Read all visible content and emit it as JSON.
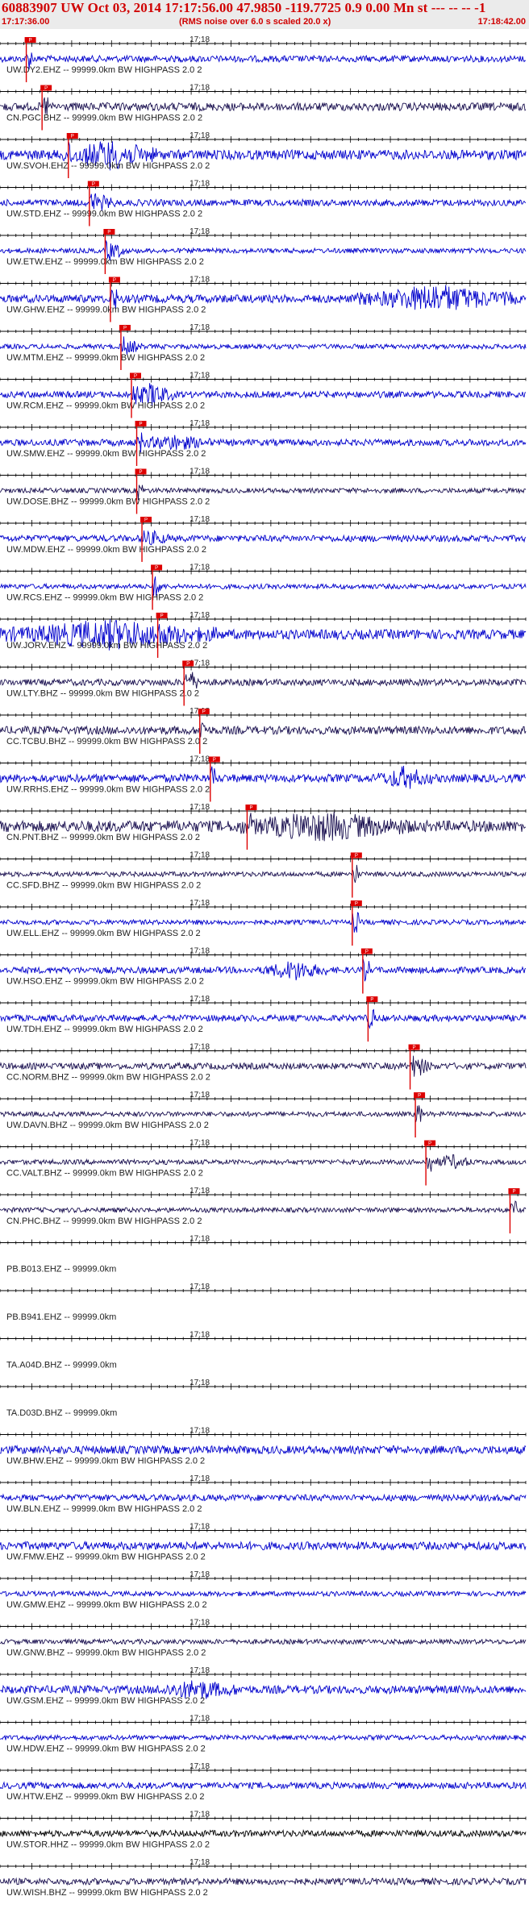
{
  "header": {
    "title": "60883907 UW Oct 03, 2014 17:17:56.00   47.9850 -119.7725  0.9 0.00 Mn st --- -- --  -1",
    "subtitle": "(RMS noise over 6.0 s scaled 20.0 x)",
    "time_start": "17:17:36.00",
    "time_end": "17:18:42.00"
  },
  "colors": {
    "title": "#d00000",
    "trace_blue": "#0000cc",
    "trace_dark": "#1a1050",
    "pick": "#dd0000",
    "axis": "#000000"
  },
  "chart_data": {
    "type": "line",
    "title": "60883907 UW Oct 03, 2014 17:17:56.00",
    "x_start": "17:17:36.00",
    "x_end": "17:18:42.00",
    "minute_tick_label": "17:18",
    "pick_label": "P",
    "traces": [
      {
        "label": "UW.DY2.EHZ -- 99999.0km BW  HIGHPASS  2.0 2",
        "pick": 0.05,
        "color": "blue",
        "amp": 4,
        "burst": null
      },
      {
        "label": "CN.PGC.BHZ -- 99999.0km BW  HIGHPASS  2.0 2",
        "pick": 0.08,
        "color": "dark",
        "amp": 5,
        "burst": null
      },
      {
        "label": "UW.SVOH.EHZ -- 99999.0km BW  HIGHPASS  2.0 2",
        "pick": 0.13,
        "color": "blue",
        "amp": 6,
        "burst": [
          0.12,
          0.3,
          14
        ]
      },
      {
        "label": "UW.STD.EHZ -- 99999.0km BW  HIGHPASS  2.0 2",
        "pick": 0.17,
        "color": "blue",
        "amp": 4,
        "burst": [
          0.17,
          0.22,
          6
        ]
      },
      {
        "label": "UW.ETW.EHZ -- 99999.0km BW  HIGHPASS  2.0 2",
        "pick": 0.2,
        "color": "blue",
        "amp": 3,
        "burst": [
          0.2,
          0.24,
          8
        ]
      },
      {
        "label": "UW.GHW.EHZ -- 99999.0km BW  HIGHPASS  2.0 2",
        "pick": 0.21,
        "color": "blue",
        "amp": 5,
        "burst": [
          0.68,
          0.98,
          14
        ]
      },
      {
        "label": "UW.MTM.EHZ -- 99999.0km BW  HIGHPASS  2.0 2",
        "pick": 0.23,
        "color": "blue",
        "amp": 3,
        "burst": [
          0.23,
          0.27,
          6
        ]
      },
      {
        "label": "UW.RCM.EHZ -- 99999.0km BW  HIGHPASS  2.0 2",
        "pick": 0.25,
        "color": "blue",
        "amp": 4,
        "burst": [
          0.25,
          0.33,
          12
        ]
      },
      {
        "label": "UW.SMW.EHZ -- 99999.0km BW  HIGHPASS  2.0 2",
        "pick": 0.26,
        "color": "blue",
        "amp": 4,
        "burst": [
          0.26,
          0.4,
          7
        ]
      },
      {
        "label": "UW.DOSE.BHZ -- 99999.0km BW  HIGHPASS  2.0 2",
        "pick": 0.26,
        "color": "dark",
        "amp": 3,
        "burst": null
      },
      {
        "label": "UW.MDW.EHZ -- 99999.0km BW  HIGHPASS  2.0 2",
        "pick": 0.27,
        "color": "blue",
        "amp": 4,
        "burst": [
          0.27,
          0.32,
          6
        ]
      },
      {
        "label": "UW.RCS.EHZ -- 99999.0km BW  HIGHPASS  2.0 2",
        "pick": 0.29,
        "color": "blue",
        "amp": 3,
        "burst": [
          0.29,
          0.31,
          10
        ]
      },
      {
        "label": "UW.JORV.EHZ -- 99999.0km BW  HIGHPASS  2.0 2",
        "pick": 0.3,
        "color": "blue",
        "amp": 6,
        "burst": [
          0.0,
          0.42,
          14
        ]
      },
      {
        "label": "UW.LTY.BHZ -- 99999.0km BW  HIGHPASS  2.0 2",
        "pick": 0.35,
        "color": "dark",
        "amp": 4,
        "burst": [
          0.35,
          0.38,
          10
        ]
      },
      {
        "label": "CC.TCBU.BHZ -- 99999.0km BW  HIGHPASS  2.0 2",
        "pick": 0.38,
        "color": "dark",
        "amp": 5,
        "burst": null
      },
      {
        "label": "UW.RRHS.EHZ -- 99999.0km BW  HIGHPASS  2.0 2",
        "pick": 0.4,
        "color": "blue",
        "amp": 5,
        "burst": [
          0.72,
          0.82,
          11
        ]
      },
      {
        "label": "CN.PNT.BHZ -- 99999.0km BW  HIGHPASS  2.0 2",
        "pick": 0.47,
        "color": "dark",
        "amp": 7,
        "burst": [
          0.45,
          0.78,
          13
        ]
      },
      {
        "label": "CC.SFD.BHZ -- 99999.0km BW  HIGHPASS  2.0 2",
        "pick": 0.67,
        "color": "dark",
        "amp": 3,
        "burst": null
      },
      {
        "label": "UW.ELL.EHZ -- 99999.0km BW  HIGHPASS  2.0 2",
        "pick": 0.67,
        "color": "blue",
        "amp": 3,
        "burst": null
      },
      {
        "label": "UW.HSO.EHZ -- 99999.0km BW  HIGHPASS  2.0 2",
        "pick": 0.69,
        "color": "blue",
        "amp": 4,
        "burst": [
          0.5,
          0.62,
          10
        ]
      },
      {
        "label": "UW.TDH.EHZ -- 99999.0km BW  HIGHPASS  2.0 2",
        "pick": 0.7,
        "color": "blue",
        "amp": 4,
        "burst": null
      },
      {
        "label": "CC.NORM.BHZ -- 99999.0km BW  HIGHPASS  2.0 2",
        "pick": 0.78,
        "color": "dark",
        "amp": 4,
        "burst": [
          0.78,
          0.82,
          8
        ]
      },
      {
        "label": "UW.DAVN.BHZ -- 99999.0km BW  HIGHPASS  2.0 2",
        "pick": 0.79,
        "color": "dark",
        "amp": 3,
        "burst": null
      },
      {
        "label": "CC.VALT.BHZ -- 99999.0km BW  HIGHPASS  2.0 2",
        "pick": 0.81,
        "color": "dark",
        "amp": 3,
        "burst": [
          0.82,
          0.9,
          7
        ]
      },
      {
        "label": "CN.PHC.BHZ -- 99999.0km BW  HIGHPASS  2.0 2",
        "pick": 0.97,
        "color": "dark",
        "amp": 3,
        "burst": null
      },
      {
        "label": "PB.B013.EHZ -- 99999.0km",
        "pick": null,
        "color": "none",
        "amp": 0,
        "burst": null
      },
      {
        "label": "PB.B941.EHZ -- 99999.0km",
        "pick": null,
        "color": "none",
        "amp": 0,
        "burst": null
      },
      {
        "label": "TA.A04D.BHZ -- 99999.0km",
        "pick": null,
        "color": "none",
        "amp": 0,
        "burst": null
      },
      {
        "label": "TA.D03D.BHZ -- 99999.0km",
        "pick": null,
        "color": "none",
        "amp": 0,
        "burst": null
      },
      {
        "label": "UW.BHW.EHZ -- 99999.0km BW  HIGHPASS  2.0 2",
        "pick": null,
        "color": "blue",
        "amp": 5,
        "burst": null
      },
      {
        "label": "UW.BLN.EHZ -- 99999.0km BW  HIGHPASS  2.0 2",
        "pick": null,
        "color": "blue",
        "amp": 4,
        "burst": null
      },
      {
        "label": "UW.FMW.EHZ -- 99999.0km BW  HIGHPASS  2.0 2",
        "pick": null,
        "color": "blue",
        "amp": 5,
        "burst": null
      },
      {
        "label": "UW.GMW.EHZ -- 99999.0km BW  HIGHPASS  2.0 2",
        "pick": null,
        "color": "blue",
        "amp": 3,
        "burst": null
      },
      {
        "label": "UW.GNW.BHZ -- 99999.0km BW  HIGHPASS  2.0 2",
        "pick": null,
        "color": "dark",
        "amp": 3,
        "burst": null
      },
      {
        "label": "UW.GSM.EHZ -- 99999.0km BW  HIGHPASS  2.0 2",
        "pick": null,
        "color": "blue",
        "amp": 5,
        "burst": [
          0.3,
          0.45,
          9
        ]
      },
      {
        "label": "UW.HDW.EHZ -- 99999.0km BW  HIGHPASS  2.0 2",
        "pick": null,
        "color": "blue",
        "amp": 3,
        "burst": null
      },
      {
        "label": "UW.HTW.EHZ -- 99999.0km BW  HIGHPASS  2.0 2",
        "pick": null,
        "color": "blue",
        "amp": 4,
        "burst": null
      },
      {
        "label": "UW.STOR.HHZ -- 99999.0km BW  HIGHPASS  2.0 2",
        "pick": null,
        "color": "black",
        "amp": 4,
        "burst": null
      },
      {
        "label": "UW.WISH.BHZ -- 99999.0km BW  HIGHPASS  2.0 2",
        "pick": null,
        "color": "dark",
        "amp": 4,
        "burst": null
      }
    ]
  }
}
